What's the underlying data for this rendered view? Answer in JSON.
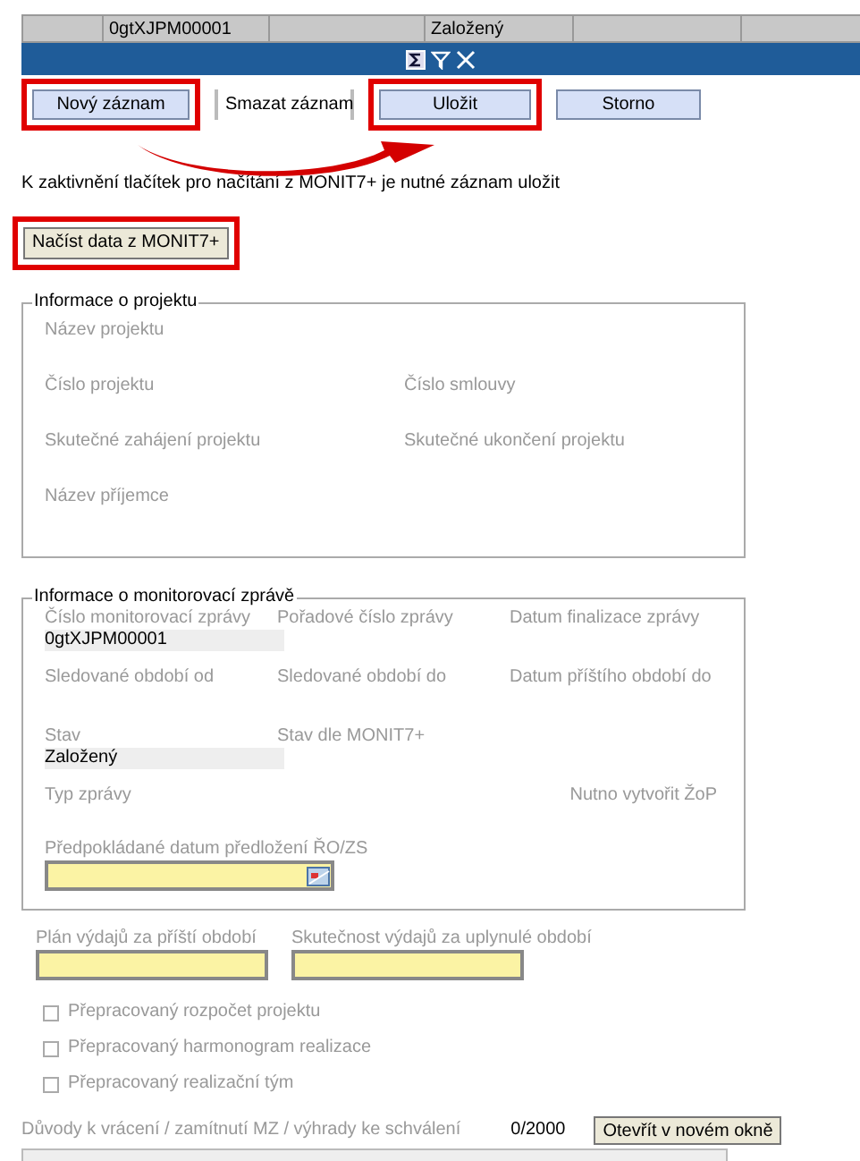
{
  "grid_row": {
    "cells": [
      {},
      {
        "text": "0gtXJPM00001"
      },
      {},
      {
        "text": "Založený"
      },
      {},
      {}
    ]
  },
  "buttons": [
    {
      "label": "Nový záznam",
      "kind": "boxed",
      "highlighted": true
    },
    {
      "label": "Smazat záznam",
      "kind": "flat",
      "highlighted": false
    },
    {
      "label": "Uložit",
      "kind": "boxed",
      "highlighted": true
    },
    {
      "label": "Storno",
      "kind": "boxed",
      "highlighted": false
    }
  ],
  "notice": "K zaktivnění tlačítek pro načítání z MONIT7+ je nutné záznam uložit",
  "load_button": {
    "label": "Načíst data z MONIT7+",
    "highlighted": true
  },
  "project_info": {
    "legend": "Informace o projektu",
    "rows": [
      [
        {
          "label": "Název projektu"
        }
      ],
      [
        {
          "label": "Číslo projektu"
        },
        {
          "label": "Číslo smlouvy"
        }
      ],
      [
        {
          "label": "Skutečné zahájení projektu"
        },
        {
          "label": "Skutečné ukončení projektu"
        }
      ],
      [
        {
          "label": "Název příjemce"
        }
      ]
    ]
  },
  "report_info": {
    "legend": "Informace o monitorovací zprávě",
    "rows": [
      [
        {
          "label": "Číslo monitorovací zprávy",
          "value": "0gtXJPM00001"
        },
        {
          "label": "Pořadové číslo zprávy"
        },
        {
          "label": "Datum finalizace zprávy"
        }
      ],
      [
        {
          "label": "Sledované období od"
        },
        {
          "label": "Sledované období do"
        },
        {
          "label": "Datum příštího období do"
        }
      ],
      [
        {
          "label": "Stav",
          "value": "Založený"
        },
        {
          "label": "Stav dle MONIT7+"
        }
      ],
      [
        {
          "label": "Typ zprávy"
        },
        {},
        {
          "label": "Nutno vytvořit ŽoP"
        }
      ]
    ],
    "date_field": {
      "label": "Předpokládané datum předložení ŘO/ZS"
    }
  },
  "expense_fields": [
    {
      "label": "Plán výdajů za příští období"
    },
    {
      "label": "Skutečnost výdajů za uplynulé období"
    }
  ],
  "checkboxes": [
    {
      "label": "Přepracovaný rozpočet projektu",
      "checked": false
    },
    {
      "label": "Přepracovaný harmonogram realizace",
      "checked": false
    },
    {
      "label": "Přepracovaný realizační tým",
      "checked": false
    }
  ],
  "reasons": {
    "label": "Důvody k vrácení / zamítnutí MZ / výhrady ke schválení",
    "counter": "0/2000",
    "button": "Otevřít v novém okně"
  }
}
